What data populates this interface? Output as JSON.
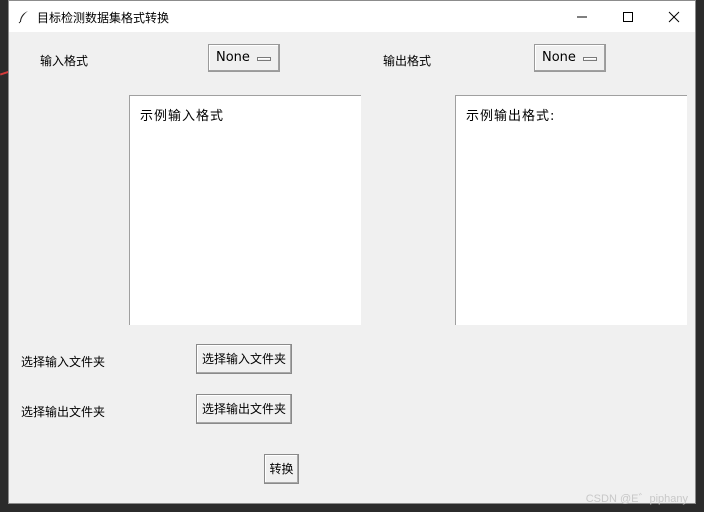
{
  "window": {
    "title": "目标检测数据集格式转换",
    "icon": "feather-icon"
  },
  "input_format": {
    "label": "输入格式",
    "selected": "None"
  },
  "output_format": {
    "label": "输出格式",
    "selected": "None"
  },
  "input_example": {
    "text": "示例输入格式"
  },
  "output_example": {
    "text": "示例输出格式:"
  },
  "input_folder": {
    "label": "选择输入文件夹",
    "button": "选择输入文件夹"
  },
  "output_folder": {
    "label": "选择输出文件夹",
    "button": "选择输出文件夹"
  },
  "convert_button": "转换",
  "watermark": "CSDN @E゛piphany"
}
